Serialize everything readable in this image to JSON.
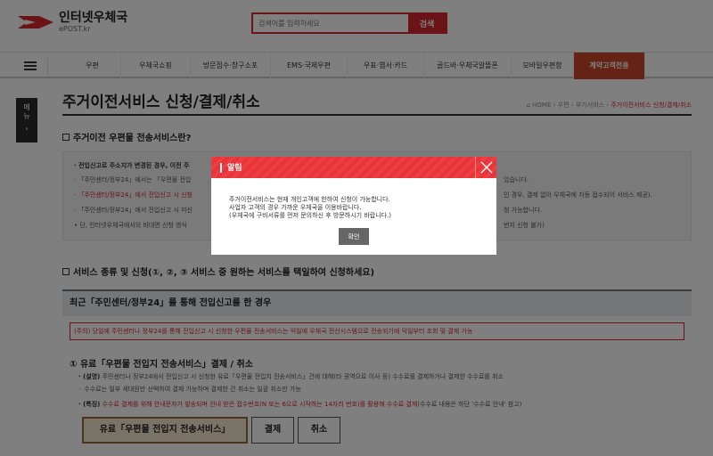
{
  "header": {
    "logo_title": "인터넷우체국",
    "logo_sub": "ePOST.kr",
    "search_placeholder": "검색어를 입력하세요",
    "search_button": "검색"
  },
  "nav": {
    "items": [
      "우편",
      "우체국쇼핑",
      "방문접수·창구소포",
      "EMS·국제우편",
      "우표·엽서·카드",
      "골드바·우체국알뜰폰",
      "모바일우편함",
      "계약고객전용"
    ]
  },
  "side_tab": {
    "label": "메\n뉴",
    "arrow": "›"
  },
  "page": {
    "title": "주거이전서비스 신청/결제/취소",
    "breadcrumb": {
      "home": "HOME",
      "sep1": "›",
      "mail": "우편",
      "sep2": "›",
      "extra": "부가서비스",
      "sep3": "›",
      "current": "주거이전서비스 신청/결제/취소"
    }
  },
  "section1": {
    "title": "주거이전 우편물 전송서비스란?",
    "lines": [
      "· 전입신고로 주소지가 변경된 경우, 이전 주",
      "· 「주민센터/정부24」에서는 「우편물 전입",
      "· 「주민센터/정부24」에서 전입신고 시 신청",
      "· 「주민센터/정부24」에서 전입신고 시 미신",
      "  • 단, 인터넷우체국에서의 비대면 신청 방식"
    ],
    "tails": [
      "있습니다.",
      "인 경우, 결제 없이 우체국에 자동 접수되어 서비스 제공).",
      "청 가능합니다.",
      "번지 신청 불가)"
    ]
  },
  "section2": {
    "title": "서비스 종류 및 신청(①, ②, ③ 서비스 중 원하는 서비스를 택일하여 신청하세요)",
    "grey_head": "최근「주민센터/정부24」를 통해 전입신고를 한 경우",
    "notice": "(주의) 당일에 주민센터나 정부24를 통해 전입신고 시 신청한 우편물 전송서비스는 익일에 우체국 전산시스템으로 전송되기에 익일부터 조회 및 결제 가능"
  },
  "option1": {
    "title": "① 유료「우편물 전입지 전송서비스」결제 / 취소",
    "desc1_label": "· (설명)",
    "desc1": " 주민센터나 정부24에서 전입신고 시 신청한 유료「우편물 전입지 전송서비스」건에 대해(타 권역으로 이사 등) 수수료를 결제하거나 결제한 수수료를 취소",
    "desc2": "  ◦ 수수료는 일부 세대원만 선택하여 결제 가능하며 결제한 건 취소는 일괄 취소만 가능",
    "desc3_label": "· (특징)",
    "desc3_red": " 수수료 결제를 위해 안내문자가 발송되며 안내 받은 접수번호(N 또는 6으로 시작하는 14자리 번호)를 활용해 수수료 결제",
    "desc3_tail": "(수수료 내용은 하단 '수수료 안내' 참고)",
    "btn_primary": "유료「우편물 전입지 전송서비스」",
    "btn_pay": "결제",
    "btn_cancel": "취소"
  },
  "modal": {
    "title": "알림",
    "line1": "주거이전서비스는 현재 개인고객에 한하여 신청이 가능합니다.",
    "line2": "사업자 고객의 경우 가까운 우체국을 이용바랍니다.",
    "line3": "(우체국에 구비서류를 먼저 문의하신 후 방문하시기 바랍니다.)",
    "ok": "확인"
  },
  "colors": {
    "brand_red": "#d6262e",
    "nav_highlight": "#c8462a",
    "modal_head": "#ee3e40"
  }
}
